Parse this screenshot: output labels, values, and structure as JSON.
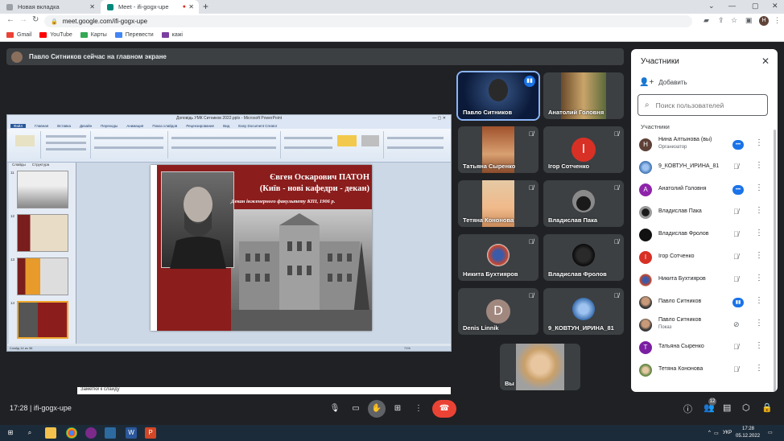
{
  "browser": {
    "tabs": [
      {
        "title": "Новая вкладка"
      },
      {
        "title": "Meet - ifi-gogx-upe"
      }
    ],
    "url": "meet.google.com/ifi-gogx-upe",
    "profile_initial": "H",
    "bookmarks": [
      "Gmail",
      "YouTube",
      "Карты",
      "Перевести",
      "кажі"
    ]
  },
  "banner": {
    "text": "Павло Ситников сейчас на главном экране"
  },
  "presentation": {
    "window_title": "Доповідь УМК Ситников 2022.pptx - Microsoft PowerPoint",
    "menu": [
      "Файл",
      "Главная",
      "Вставка",
      "Дизайн",
      "Переходы",
      "Анимация",
      "Показ слайдов",
      "Рецензирование",
      "Вид",
      "Easy Document Creator"
    ],
    "thumb_tabs": [
      "Слайды",
      "Структура"
    ],
    "thumb_numbers": [
      "11",
      "12",
      "13",
      "14"
    ],
    "slide_title_line1": "Євген Оскарович ПАТОН",
    "slide_title_line2": "(Київ - нові кафедри - декан)",
    "slide_subtitle": "Декан інженерного факультету КПІ, 1906 р.",
    "notes_placeholder": "Заметки к слайду",
    "status": "Слайд 14 из 36",
    "zoom": "71%"
  },
  "tiles": [
    {
      "name": "Павло Ситников",
      "speaking": true
    },
    {
      "name": "Анатолий Головня"
    },
    {
      "name": "Татьяна Сыренко"
    },
    {
      "name": "Ігор Сотченко",
      "initial": "I"
    },
    {
      "name": "Тетяна Кононова"
    },
    {
      "name": "Владислав Пака"
    },
    {
      "name": "Никита Бухтияров"
    },
    {
      "name": "Владислав Фролов"
    },
    {
      "name": "Denis Linnik",
      "initial": "D"
    },
    {
      "name": "9_КОВТУН_ИРИНА_81"
    },
    {
      "name": "Вы"
    }
  ],
  "panel": {
    "title": "Участники",
    "add_label": "Добавить",
    "search_placeholder": "Поиск пользователей",
    "section_label": "Участники",
    "participants": [
      {
        "name": "Нина Алтынова (вы)",
        "sub": "Организатор",
        "initial": "Н"
      },
      {
        "name": "9_КОВТУН_ИРИНА_81"
      },
      {
        "name": "Анатолий Головня",
        "initial": "А"
      },
      {
        "name": "Владислав Пака"
      },
      {
        "name": "Владислав Фролов"
      },
      {
        "name": "Ігор Сотченко",
        "initial": "I"
      },
      {
        "name": "Никита Бухтияров"
      },
      {
        "name": "Павло Ситников"
      },
      {
        "name": "Павло Ситников",
        "sub": "Показ"
      },
      {
        "name": "Татьяна Сыренко",
        "initial": "Т"
      },
      {
        "name": "Тетяна Кононова"
      }
    ]
  },
  "bottom": {
    "time_code": "17:28 | ifi-gogx-upe",
    "people_count": "12"
  },
  "taskbar": {
    "lang": "УКР",
    "clock_time": "17:28",
    "clock_date": "05.12.2022"
  },
  "colors": {
    "meet_bg": "#202124",
    "tile_bg": "#3c4043",
    "end_call": "#ea4335",
    "accent": "#1a73e8",
    "slide_red": "#8b1d1d"
  }
}
